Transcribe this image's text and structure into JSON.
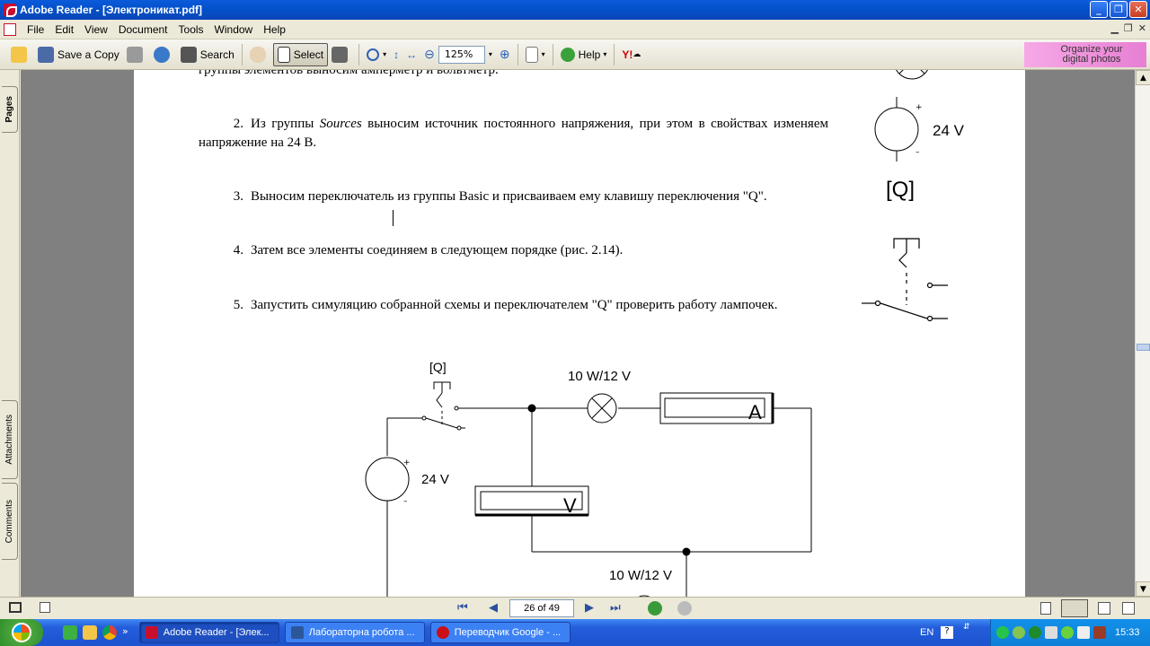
{
  "window": {
    "title": "Adobe Reader - [Электроникат.pdf]"
  },
  "menu": [
    "File",
    "Edit",
    "View",
    "Document",
    "Tools",
    "Window",
    "Help"
  ],
  "toolbar": {
    "save_copy": "Save a Copy",
    "search": "Search",
    "select": "Select",
    "zoom": "125%",
    "help": "Help",
    "promo": "Organize your digital photos"
  },
  "sidepanel": {
    "pages": "Pages",
    "attachments": "Attachments",
    "comments": "Comments"
  },
  "document": {
    "top_fragment": "группы элементов выносим амперметр и вольтметр.",
    "items": [
      {
        "num": "2.",
        "text_pre": "Из группы ",
        "text_em": "Sources",
        "text_post": " выносим источник постоянного напряжения, при этом в свойствах изменяем напряжение на 24 В."
      },
      {
        "num": "3.",
        "text": "Выносим переключатель из группы Basic и присваиваем ему клавишу переключения \"Q\"."
      },
      {
        "num": "4.",
        "text": "Затем все элементы соединяем в следующем порядке (рис. 2.14)."
      },
      {
        "num": "5.",
        "text": "Запустить симуляцию собранной схемы и переключателем \"Q\" проверить работу лампочек."
      }
    ],
    "side_labels": {
      "source_voltage": "24 V",
      "switch_key": "[Q]"
    },
    "circuit": {
      "switch_key": "[Q]",
      "lamp1": "10 W/12 V",
      "lamp2": "10 W/12 V",
      "ammeter": "A",
      "voltmeter": "V",
      "source": "24 V",
      "plus": "+",
      "minus": "–"
    }
  },
  "status": {
    "page": "26 of 49"
  },
  "taskbar": {
    "tasks": [
      "Adobe Reader - [Элек...",
      "Лабораторна робота ...",
      "Переводчик Google - ..."
    ],
    "lang": "EN",
    "clock": "15:33"
  }
}
